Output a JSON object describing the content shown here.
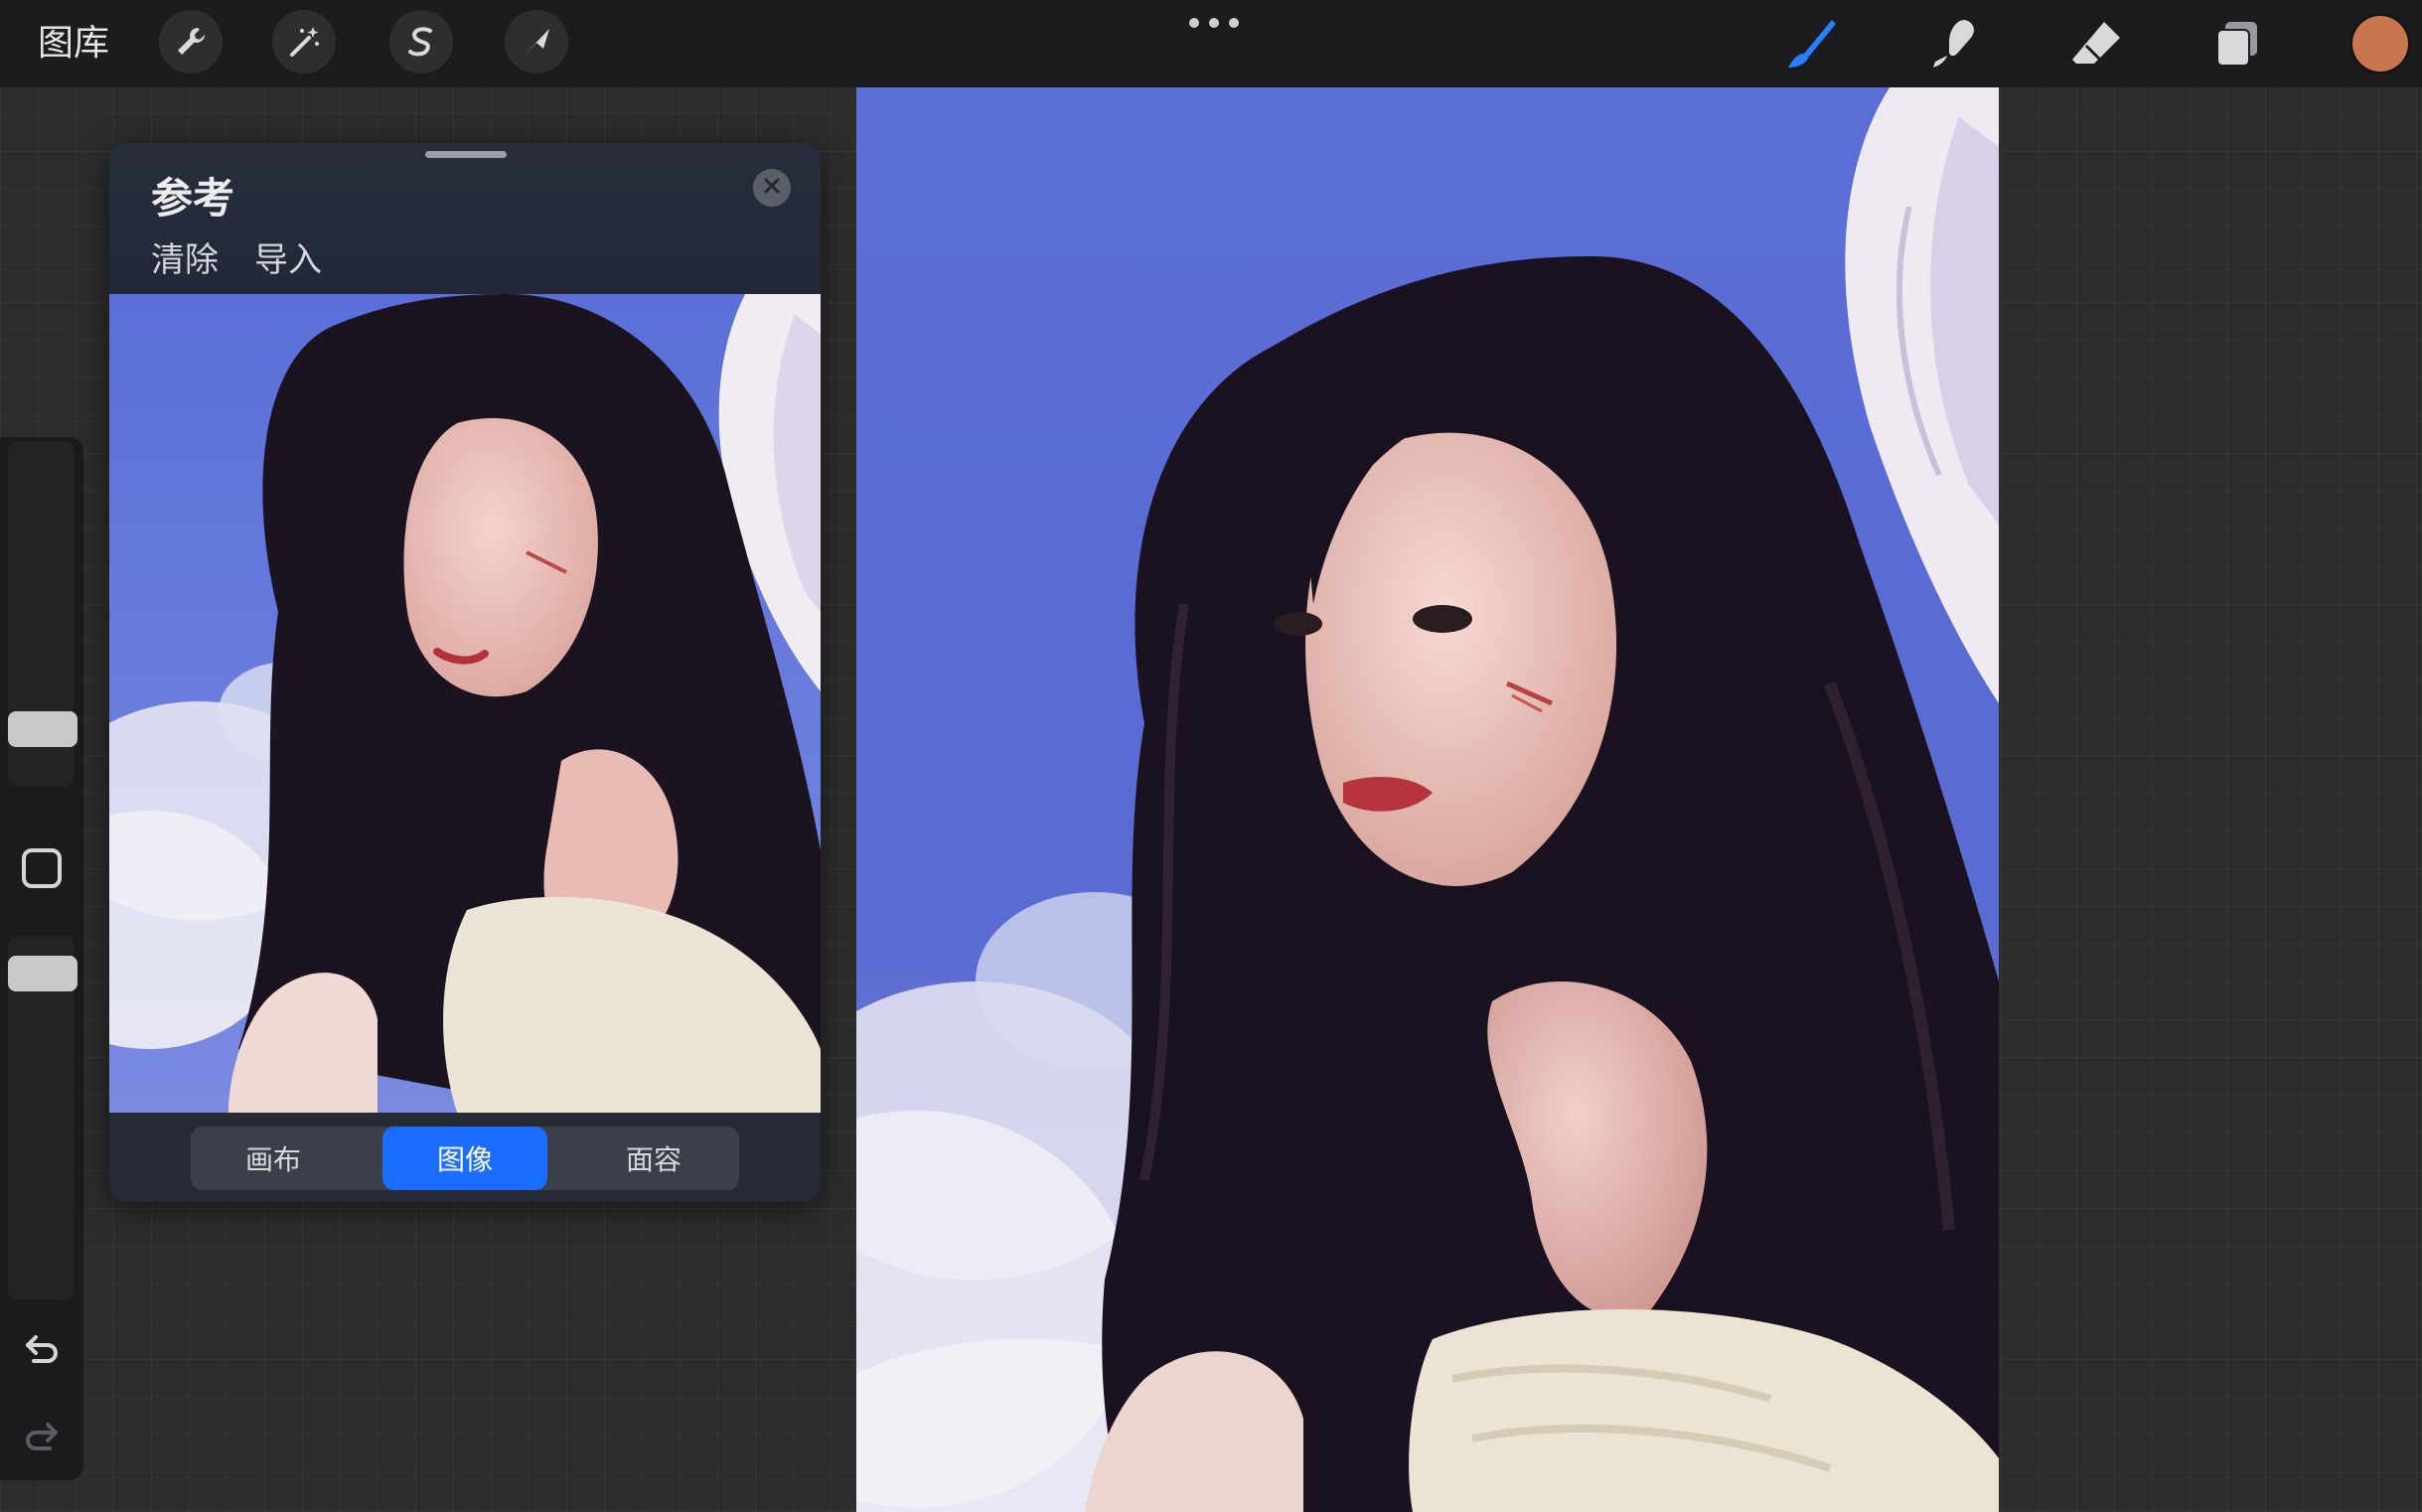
{
  "toolbar": {
    "gallery_label": "图库",
    "left_tools": [
      "wrench-icon",
      "magic-wand-icon",
      "selection-s-icon",
      "transform-arrow-icon"
    ],
    "right_tools": [
      "brush-icon",
      "smudge-icon",
      "eraser-icon",
      "layers-icon"
    ],
    "active_tool": "brush-icon",
    "current_color": "#c8764e"
  },
  "reference": {
    "title": "参考",
    "clear_label": "清除",
    "import_label": "导入",
    "modes": [
      "画布",
      "图像",
      "面容"
    ],
    "active_mode": "图像"
  },
  "sidebar": {
    "controls": [
      "brush-size-slider",
      "modify-button",
      "opacity-slider",
      "undo-icon",
      "redo-icon"
    ]
  }
}
